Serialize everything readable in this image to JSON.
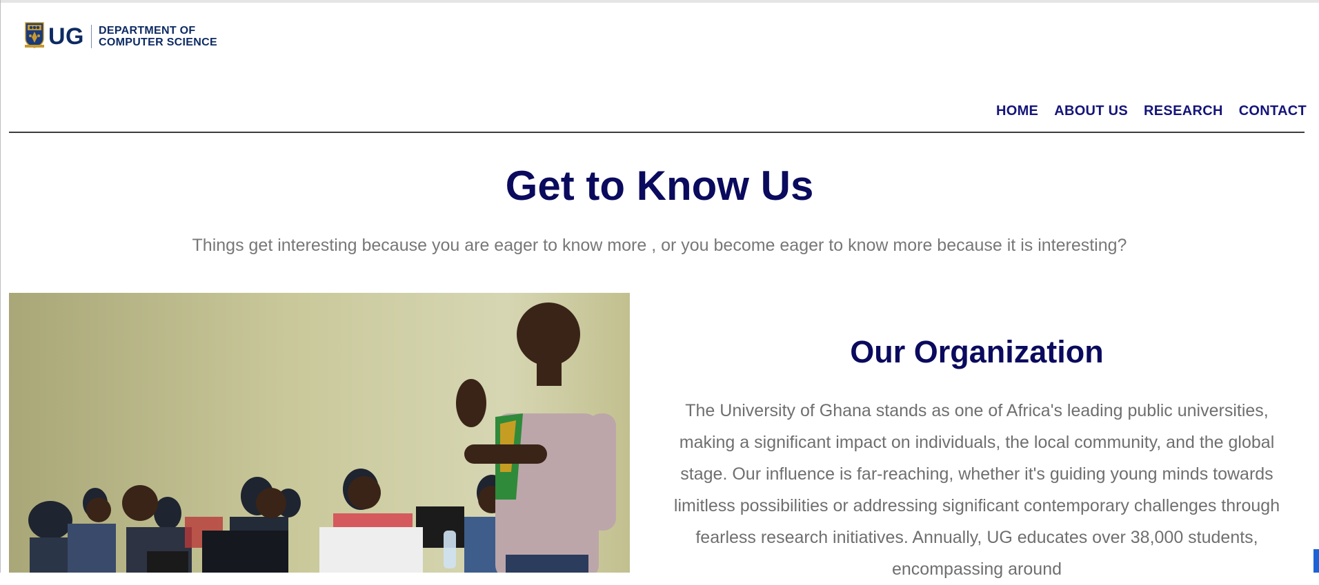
{
  "header": {
    "logo_mark": "UG",
    "logo_line1": "DEPARTMENT OF",
    "logo_line2": "COMPUTER SCIENCE"
  },
  "nav": {
    "items": [
      "HOME",
      "ABOUT US",
      "RESEARCH",
      "CONTACT"
    ]
  },
  "hero": {
    "title": "Get to Know Us",
    "tagline": "Things get interesting because you are eager to know more , or you become eager to know more because it is interesting?"
  },
  "organization": {
    "title": "Our Organization",
    "body": "The University of Ghana stands as one of Africa's leading public universities, making a significant impact on individuals, the local community, and the global stage. Our influence is far-reaching, whether it's guiding young minds towards limitless possibilities or addressing significant contemporary challenges through fearless research initiatives. Annually, UG educates over 38,000 students, encompassing around"
  },
  "colors": {
    "brand_navy": "#0a0a5e",
    "nav_blue": "#14147a",
    "logo_navy": "#0d2a63",
    "body_gray": "#6f6f6f"
  }
}
